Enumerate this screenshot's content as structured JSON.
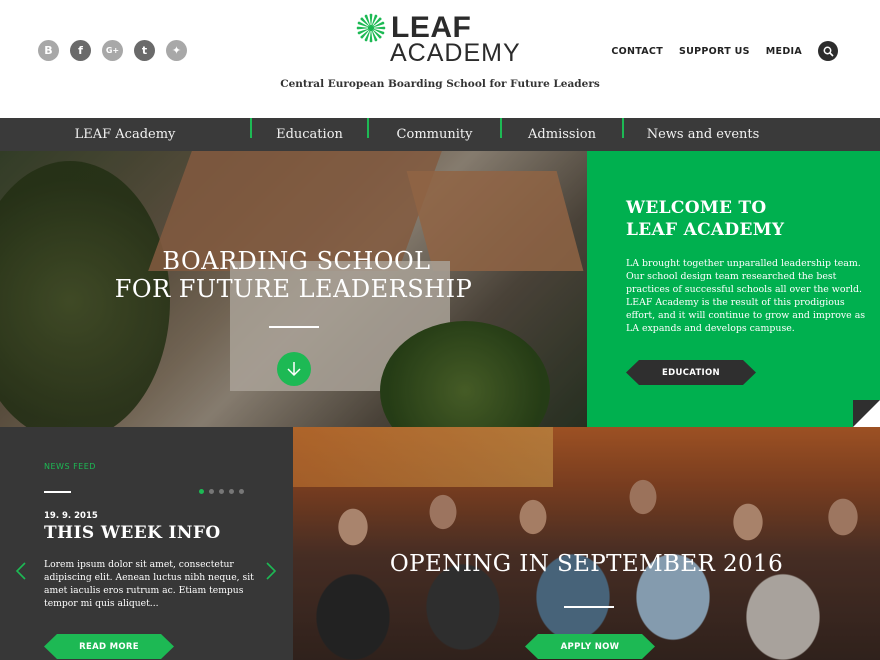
{
  "header": {
    "logo_top": "LEAF",
    "logo_bottom": "ACADEMY",
    "tagline": "Central European Boarding School for Future Leaders",
    "socials": [
      {
        "icon": "blogger-icon",
        "glyph": "B"
      },
      {
        "icon": "facebook-icon",
        "glyph": "f"
      },
      {
        "icon": "google-plus-icon",
        "glyph": "G+"
      },
      {
        "icon": "tumblr-icon",
        "glyph": "t"
      },
      {
        "icon": "twitter-icon",
        "glyph": "✦"
      }
    ],
    "topnav": [
      "CONTACT",
      "SUPPORT US",
      "MEDIA"
    ],
    "search_icon": "search-icon"
  },
  "mainnav": [
    "LEAF Academy",
    "Education",
    "Community",
    "Admission",
    "News and events"
  ],
  "hero": {
    "title_line1": "BOARDING SCHOOL",
    "title_line2": "FOR FUTURE LEADERSHIP",
    "down_icon": "arrow-down-icon"
  },
  "welcome": {
    "title_line1": "WELCOME TO",
    "title_line2": "LEAF ACADEMY",
    "text": "LA brought together unparalled leadership team. Our school design team researched the best practices of successful schools all over the world. LEAF Academy  is the result of this prodigious effort, and it will continue to grow and improve as LA  expands and develops campuse.",
    "button": "EDUCATION"
  },
  "news": {
    "label": "NEWS FEED",
    "date": "19. 9. 2015",
    "title": "THIS WEEK INFO",
    "text": "Lorem ipsum dolor sit amet, consectetur adipiscing elit. Aenean luctus nibh neque, sit amet iaculis eros rutrum ac. Etiam tempus tempor mi quis aliquet...",
    "button": "READ MORE",
    "dots_total": 5,
    "dots_active_index": 0
  },
  "opening": {
    "title": "OPENING IN SEPTEMBER 2016",
    "button": "APPLY NOW"
  },
  "colors": {
    "brand_green": "#1db954",
    "welcome_green": "#00b04f",
    "dark": "#373737",
    "nav": "#3a3a3a"
  }
}
